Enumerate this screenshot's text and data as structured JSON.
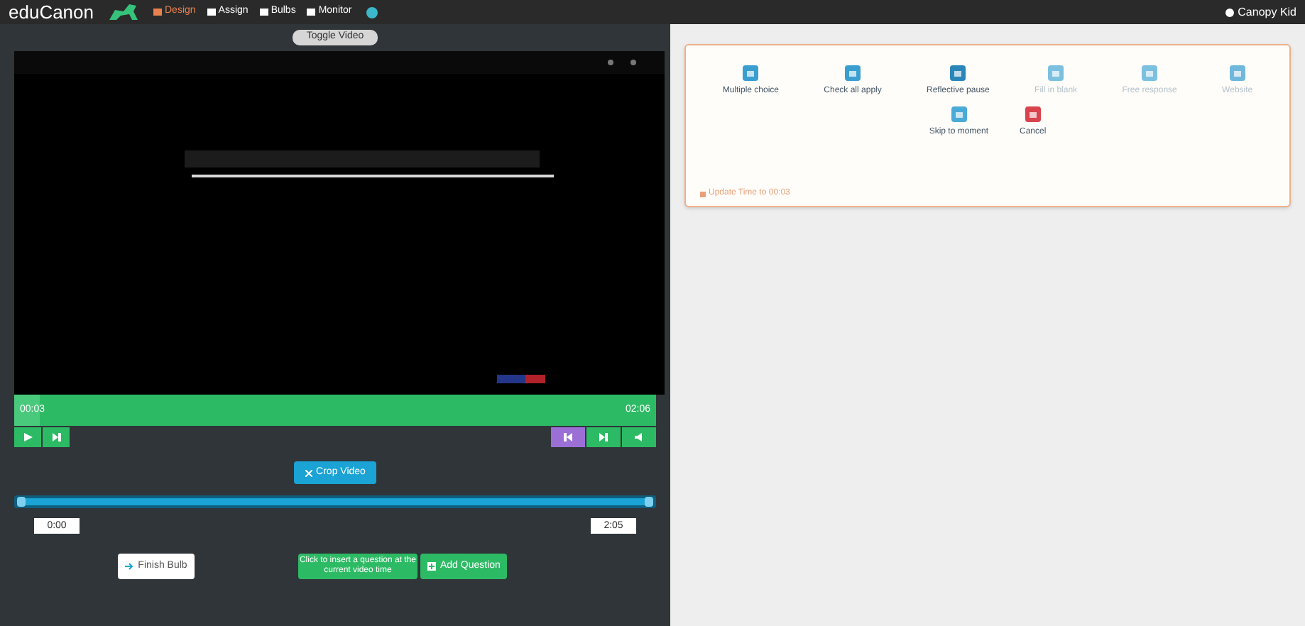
{
  "navbar": {
    "brand": "eduCanon",
    "items": [
      {
        "label": "Design",
        "selected": true
      },
      {
        "label": "Assign",
        "selected": false
      },
      {
        "label": "Bulbs",
        "selected": false
      },
      {
        "label": "Monitor",
        "selected": false
      }
    ],
    "user": "Canopy Kid"
  },
  "toggle_button": "Toggle Video",
  "timeline": {
    "level": 0.04,
    "current": "00:03",
    "total": "02:06"
  },
  "crop_button": "Crop Video",
  "crop_range": {
    "start": "0:00",
    "end": "2:05",
    "level": 1
  },
  "finish_button": "Finish Bulb",
  "hint": "Click to insert a question at the current video time",
  "add_button": "Add Question",
  "question_types": [
    {
      "label": "Multiple choice",
      "disabled": false,
      "color": "#3a9fd0"
    },
    {
      "label": "Check all apply",
      "disabled": false,
      "color": "#3a9fd0"
    },
    {
      "label": "Reflective pause",
      "disabled": false,
      "color": "#2a86b8"
    },
    {
      "label": "Fill in blank",
      "disabled": true,
      "color": "#7cc0e0"
    },
    {
      "label": "Free response",
      "disabled": true,
      "color": "#7cc0e0"
    },
    {
      "label": "Website",
      "disabled": true,
      "color": "#6fb8dc"
    },
    {
      "label": "Skip to moment",
      "disabled": false,
      "color": "#4aaad8"
    },
    {
      "label": "Cancel",
      "disabled": false,
      "color": "#d9434e"
    }
  ],
  "update_link": "Update Time to 00:03"
}
